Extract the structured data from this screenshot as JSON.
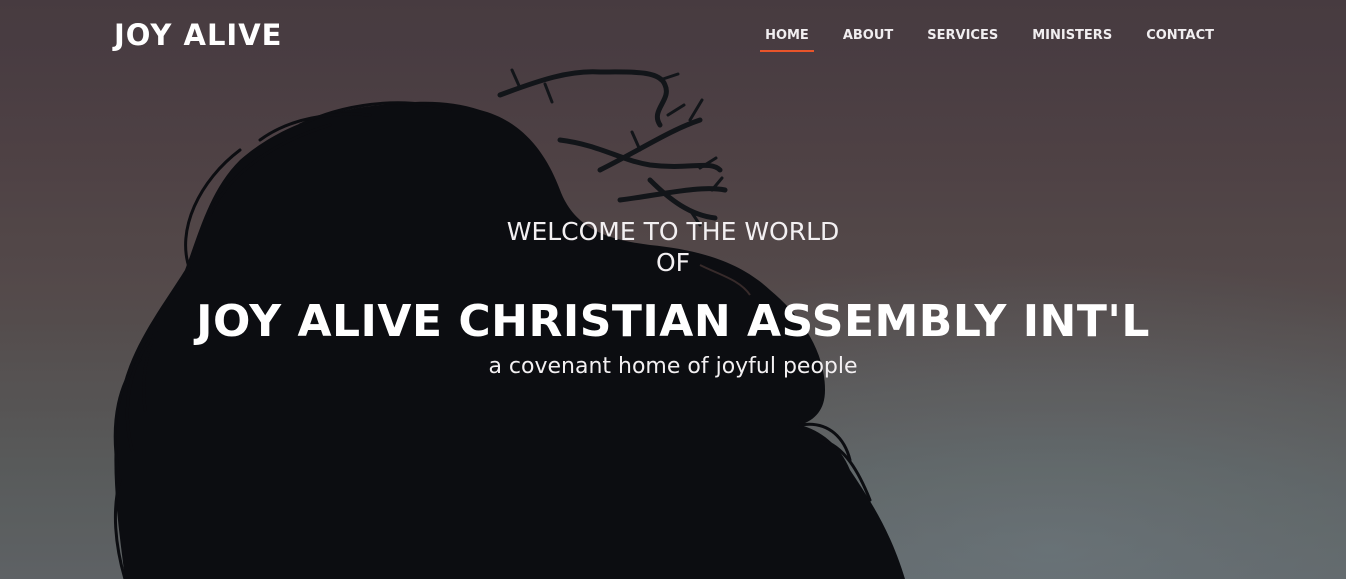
{
  "header": {
    "brand": "JOY ALIVE",
    "nav": [
      {
        "label": "HOME",
        "active": true
      },
      {
        "label": "ABOUT",
        "active": false
      },
      {
        "label": "SERVICES",
        "active": false
      },
      {
        "label": "MINISTERS",
        "active": false
      },
      {
        "label": "CONTACT",
        "active": false
      }
    ]
  },
  "hero": {
    "welcome": "WELCOME TO THE WORLD",
    "of": "OF",
    "title": "JOY ALIVE CHRISTIAN ASSEMBLY INT'L",
    "tagline": "a covenant home of joyful people"
  },
  "colors": {
    "accent": "#e8542a",
    "text": "#ffffff",
    "silhouette": "#0b0e12"
  }
}
